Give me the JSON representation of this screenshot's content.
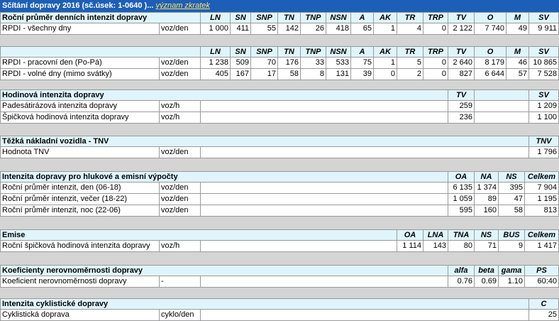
{
  "title": {
    "text": "Sčítání dopravy 2016 (sč.úsek: 1-0640 )...",
    "link": "význam zkratek"
  },
  "section1": {
    "heading": "Roční průměr denních intenzit dopravy",
    "columns": [
      "LN",
      "SN",
      "SNP",
      "TN",
      "TNP",
      "NSN",
      "A",
      "AK",
      "TR",
      "TRP",
      "TV",
      "O",
      "M",
      "SV"
    ],
    "rows": [
      {
        "label": "RPDI - všechny dny",
        "unit": "voz/den",
        "values": [
          "1 000",
          "411",
          "55",
          "142",
          "26",
          "418",
          "65",
          "1",
          "4",
          "0",
          "2 122",
          "7 740",
          "49",
          "9 911"
        ]
      }
    ]
  },
  "section2": {
    "columns": [
      "LN",
      "SN",
      "SNP",
      "TN",
      "TNP",
      "NSN",
      "A",
      "AK",
      "TR",
      "TRP",
      "TV",
      "O",
      "M",
      "SV"
    ],
    "rows": [
      {
        "label": "RPDI - pracovní den (Po-Pá)",
        "unit": "voz/den",
        "values": [
          "1 238",
          "509",
          "70",
          "176",
          "33",
          "533",
          "75",
          "1",
          "5",
          "0",
          "2 640",
          "8 179",
          "46",
          "10 865"
        ]
      },
      {
        "label": "RPDI - volné dny (mimo svátky)",
        "unit": "voz/den",
        "values": [
          "405",
          "167",
          "17",
          "58",
          "8",
          "131",
          "39",
          "0",
          "2",
          "0",
          "827",
          "6 644",
          "57",
          "7 528"
        ]
      }
    ]
  },
  "section3": {
    "heading": "Hodinová intenzita dopravy",
    "columns": [
      "TV",
      "SV"
    ],
    "rows": [
      {
        "label": "Padesátirázová intenzita dopravy",
        "unit": "voz/h",
        "values": [
          "259",
          "1 209"
        ]
      },
      {
        "label": "Špičková hodinová intenzita dopravy",
        "unit": "voz/h",
        "values": [
          "236",
          "1 100"
        ]
      }
    ]
  },
  "section4": {
    "heading": "Těžká nákladní vozidla - TNV",
    "columns": [
      "TNV"
    ],
    "rows": [
      {
        "label": "Hodnota TNV",
        "unit": "voz/den",
        "values": [
          "1 796"
        ]
      }
    ]
  },
  "section5": {
    "heading": "Intenzita dopravy pro hlukové a emisní výpočty",
    "columns": [
      "OA",
      "NA",
      "NS",
      "Celkem"
    ],
    "rows": [
      {
        "label": "Roční průměr intenzit, den (06-18)",
        "unit": "voz/den",
        "values": [
          "6 135",
          "1 374",
          "395",
          "7 904"
        ]
      },
      {
        "label": "Roční průměr intenzit, večer (18-22)",
        "unit": "voz/den",
        "values": [
          "1 059",
          "89",
          "47",
          "1 195"
        ]
      },
      {
        "label": "Roční průměr intenzit, noc (22-06)",
        "unit": "voz/den",
        "values": [
          "595",
          "160",
          "58",
          "813"
        ]
      }
    ]
  },
  "section6": {
    "heading": "Emise",
    "columns": [
      "OA",
      "LNA",
      "TNA",
      "NS",
      "BUS",
      "Celkem"
    ],
    "rows": [
      {
        "label": "Roční špičková hodinová intenzita dopravy",
        "unit": "voz/h",
        "values": [
          "1 114",
          "143",
          "80",
          "71",
          "9",
          "1 417"
        ]
      }
    ]
  },
  "section7": {
    "heading": "Koeficienty nerovnoměrnosti dopravy",
    "columns": [
      "alfa",
      "beta",
      "gama",
      "PS"
    ],
    "rows": [
      {
        "label": "Koeficient nerovnoměrnosti dopravy",
        "unit": "-",
        "values": [
          "0.76",
          "0.69",
          "1.10",
          "60:40"
        ]
      }
    ]
  },
  "section8": {
    "heading": "Intenzita cyklistické dopravy",
    "columns": [
      "C"
    ],
    "rows": [
      {
        "label": "Cyklistická doprava",
        "unit": "cyklo/den",
        "values": [
          "25"
        ]
      }
    ]
  }
}
